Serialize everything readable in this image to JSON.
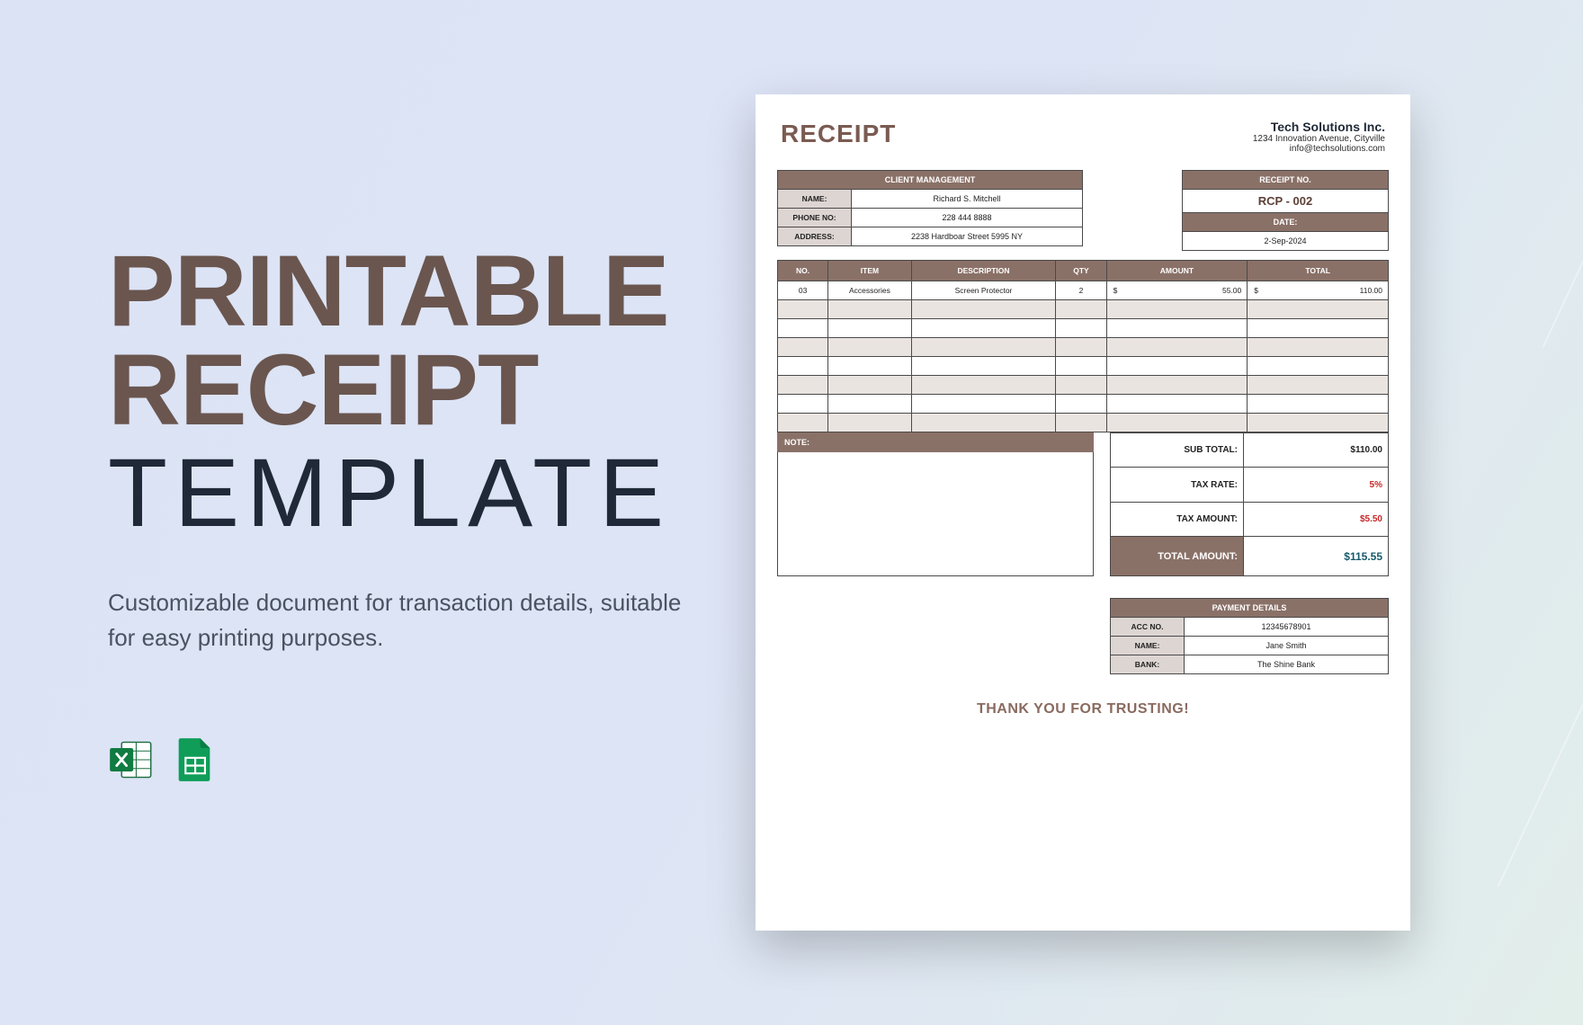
{
  "promo": {
    "title_line1": "PRINTABLE",
    "title_line2": "RECEIPT",
    "title_line3": "TEMPLATE",
    "subtitle": "Customizable document for transaction details, suitable for easy printing purposes."
  },
  "receipt": {
    "heading": "RECEIPT",
    "company": {
      "name": "Tech Solutions Inc.",
      "address": "1234 Innovation Avenue, Cityville",
      "email": "info@techsolutions.com"
    },
    "client_header": "CLIENT MANAGEMENT",
    "client": {
      "name_label": "NAME:",
      "name": "Richard S. Mitchell",
      "phone_label": "PHONE NO:",
      "phone": "228 444 8888",
      "address_label": "ADDRESS:",
      "address": "2238 Hardboar Street 5995 NY"
    },
    "meta": {
      "rcp_header": "RECEIPT NO.",
      "rcp_value": "RCP - 002",
      "date_header": "DATE:",
      "date_value": "2-Sep-2024"
    },
    "columns": {
      "no": "NO.",
      "item": "ITEM",
      "desc": "DESCRIPTION",
      "qty": "QTY",
      "amount": "AMOUNT",
      "total": "TOTAL"
    },
    "items": [
      {
        "no": "03",
        "item": "Accessories",
        "desc": "Screen Protector",
        "qty": "2",
        "amount": "55.00",
        "total": "110.00"
      }
    ],
    "currency": "$",
    "totals": {
      "subtotal_label": "SUB TOTAL:",
      "subtotal_value": "110.00",
      "taxrate_label": "TAX RATE:",
      "taxrate_value": "5%",
      "taxamount_label": "TAX AMOUNT:",
      "taxamount_value": "5.50",
      "total_label": "TOTAL AMOUNT:",
      "total_value": "115.55"
    },
    "note_label": "NOTE:",
    "payment": {
      "header": "PAYMENT DETAILS",
      "acc_label": "ACC NO.",
      "acc": "12345678901",
      "name_label": "NAME:",
      "name": "Jane Smith",
      "bank_label": "BANK:",
      "bank": "The Shine Bank"
    },
    "thanks": "THANK YOU FOR TRUSTING!"
  }
}
